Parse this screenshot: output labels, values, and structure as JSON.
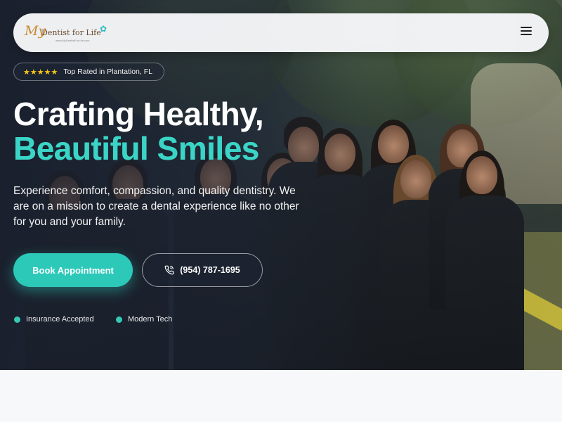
{
  "navbar": {
    "logo": {
      "my": "My",
      "name": "Dentist for Life",
      "url": "www.MyDentistForLife.com"
    },
    "menu_icon": "hamburger-menu-icon"
  },
  "badge": {
    "stars": "★★★★★",
    "text": "Top Rated in Plantation, FL"
  },
  "hero": {
    "headline_line1": "Crafting Healthy,",
    "headline_line2": "Beautiful Smiles",
    "subtext": "Experience comfort, compassion, and quality dentistry. We are on a mission to create a dental experience like no other for you and your family."
  },
  "cta": {
    "book_label": "Book Appointment",
    "phone_label": "(954) 787-1695",
    "phone_icon": "phone-icon"
  },
  "features": [
    "Insurance Accepted",
    "Modern Tech"
  ],
  "colors": {
    "accent": "#2cc9b9",
    "headline_accent": "#3ad5c7",
    "star": "#f5c518",
    "hero_overlay": "#1e2636"
  }
}
